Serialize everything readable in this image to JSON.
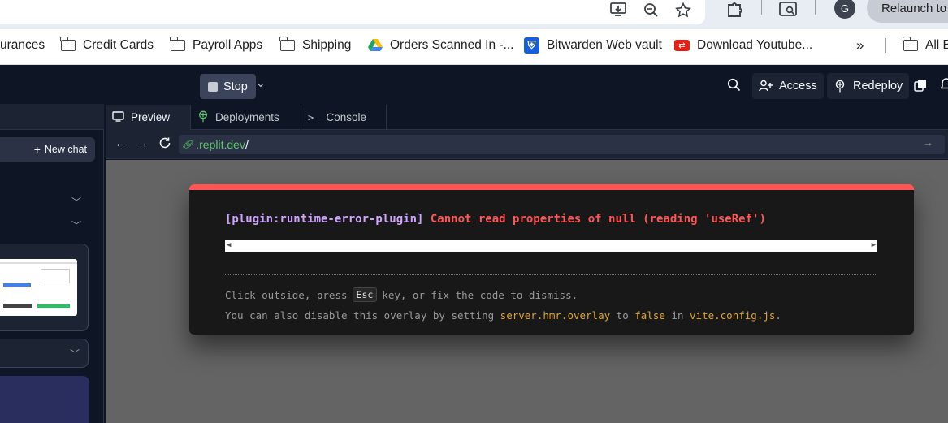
{
  "chrome": {
    "relaunch_label": "Relaunch to u",
    "profile_initial": "G"
  },
  "bookmarks": [
    {
      "label": "urances",
      "icon": "folder-icon"
    },
    {
      "label": "Credit Cards",
      "icon": "folder-icon"
    },
    {
      "label": "Payroll Apps",
      "icon": "folder-icon"
    },
    {
      "label": "Shipping",
      "icon": "folder-icon"
    },
    {
      "label": "Orders Scanned In -...",
      "icon": "google-drive-icon"
    },
    {
      "label": "Bitwarden Web vault",
      "icon": "bitwarden-icon"
    },
    {
      "label": "Download Youtube...",
      "icon": "youtube-download-icon"
    },
    {
      "label": "All B",
      "icon": "folder-icon"
    }
  ],
  "header": {
    "stop_label": "Stop",
    "access_label": "Access",
    "redeploy_label": "Redeploy"
  },
  "left_panel": {
    "new_chat_label": "New chat"
  },
  "workspace": {
    "tabs": [
      {
        "label": "Preview",
        "icon": "monitor-icon",
        "active": true
      },
      {
        "label": "Deployments",
        "icon": "deploy-icon",
        "active": false
      },
      {
        "label": "Console",
        "icon": "terminal-icon",
        "active": false
      }
    ],
    "url_host": ".replit.dev",
    "url_path": "/"
  },
  "overlay": {
    "plugin": "[plugin:runtime-error-plugin]",
    "message": "Cannot read properties of null (reading 'useRef')",
    "tip1_before": "Click outside, press",
    "tip1_key": "Esc",
    "tip1_after": "key, or fix the code to dismiss.",
    "tip2_a": "You can also disable this overlay by setting",
    "tip2_setting": "server.hmr.overlay",
    "tip2_b": "to",
    "tip2_value": "false",
    "tip2_c": "in",
    "tip2_file": "vite.config.js",
    "tip2_d": "."
  },
  "colors": {
    "error_red": "#ff5555",
    "plugin_purple": "#cfa4ff",
    "highlight_yellow": "#e0a42a",
    "replit_bg": "#0e1525"
  }
}
